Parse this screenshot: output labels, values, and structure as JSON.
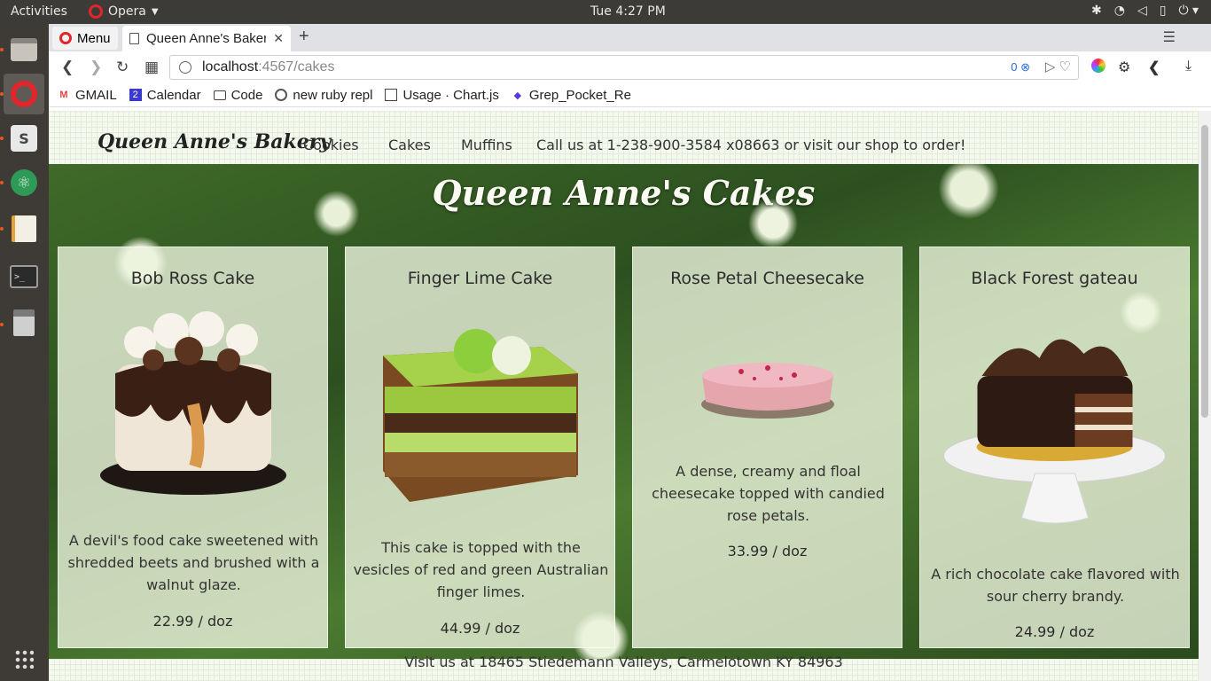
{
  "os": {
    "activities": "Activities",
    "app_name": "Opera",
    "clock": "Tue  4:27 PM"
  },
  "browser": {
    "menu_label": "Menu",
    "tab_title": "Queen Anne's Baker",
    "url_host": "localhost",
    "url_rest": ":4567/cakes",
    "adblock_count": "0",
    "bookmarks": [
      {
        "label": "GMAIL",
        "icon": "gmail-icon"
      },
      {
        "label": "Calendar",
        "icon": "calendar-icon"
      },
      {
        "label": "Code",
        "icon": "folder-icon"
      },
      {
        "label": "new ruby repl",
        "icon": "repl-icon"
      },
      {
        "label": "Usage · Chart.js",
        "icon": "book-icon"
      },
      {
        "label": "Grep_Pocket_Re",
        "icon": "pocket-icon"
      }
    ]
  },
  "site": {
    "brand": "Queen Anne's Bakery",
    "nav": [
      "Cookies",
      "Cakes",
      "Muffins"
    ],
    "call": "Call us at 1-238-900-3584 x08663 or visit our shop to order!",
    "hero_title": "Queen Anne's Cakes",
    "cakes": [
      {
        "name": "Bob Ross Cake",
        "description": "A devil's food cake sweetened with shredded beets and brushed with a walnut glaze.",
        "price": "22.99 / doz"
      },
      {
        "name": "Finger Lime Cake",
        "description": "This cake is topped with the vesicles of red and green Australian finger limes.",
        "price": "44.99 / doz"
      },
      {
        "name": "Rose Petal Cheesecake",
        "description": "A dense, creamy and floal cheesecake topped with candied rose petals.",
        "price": "33.99 / doz"
      },
      {
        "name": "Black Forest gateau",
        "description": "A rich chocolate cake flavored with sour cherry brandy.",
        "price": "24.99 / doz"
      }
    ],
    "footer": "Visit us at 18465 Stiedemann Valleys, Carmelotown KY 84963"
  },
  "colors": {
    "opera_red": "#e0262b",
    "ubuntu_orange": "#e95420",
    "card_bg": "#ecf4dd"
  }
}
